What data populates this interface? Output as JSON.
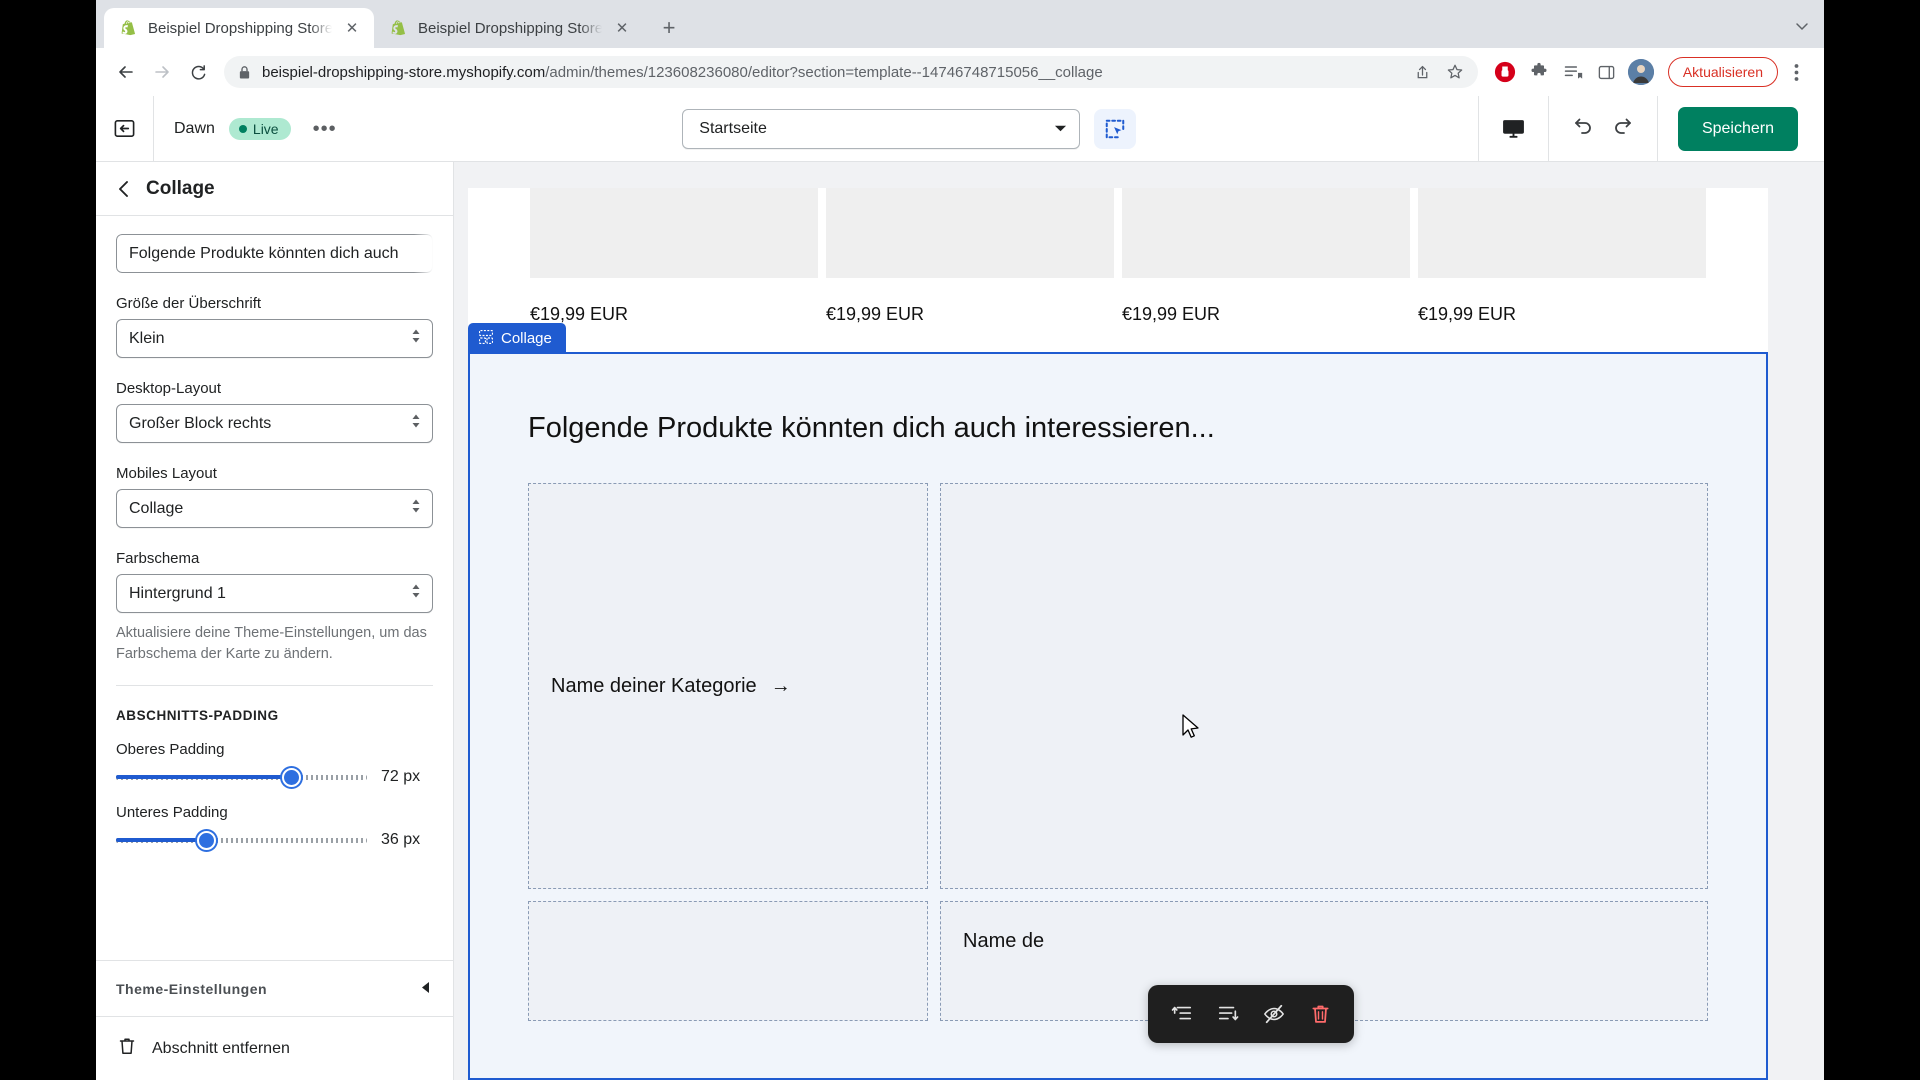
{
  "browser": {
    "tabs": [
      {
        "title": "Beispiel Dropshipping Store · D",
        "favicon": "shopify-icon",
        "active": true,
        "close_label": "✕"
      },
      {
        "title": "Beispiel Dropshipping Store · B",
        "favicon": "shopify-icon",
        "active": false,
        "close_label": "✕"
      }
    ],
    "new_tab_label": "+",
    "nav": {
      "back": "back-arrow-icon",
      "forward": "forward-arrow-icon",
      "reload": "reload-icon"
    },
    "omnibox": {
      "lock_icon": "lock-icon",
      "url_host": "beispiel-dropshipping-store.myshopify.com",
      "url_path": "/admin/themes/123608236080/editor?section=template--14746748715056__collage",
      "share_icon": "share-icon",
      "bookmark_icon": "star-icon"
    },
    "actions": {
      "adblock_icon": "adblock-icon",
      "extensions_icon": "puzzle-piece-icon",
      "reading_list_icon": "reading-list-icon",
      "side_panel_icon": "side-panel-icon",
      "profile_icon": "profile-avatar",
      "update_label": "Aktualisieren",
      "menu_icon": "kebab-menu-icon"
    }
  },
  "editor": {
    "exit_icon": "exit-editor-icon",
    "theme_name": "Dawn",
    "live_badge": "Live",
    "more_actions": "•••",
    "page_selector": {
      "value": "Startseite",
      "chevron": "chevron-down-icon"
    },
    "inspect_icon": "inspector-select-icon",
    "device_icon": "desktop-preview-icon",
    "undo_icon": "undo-icon",
    "redo_icon": "redo-icon",
    "save_label": "Speichern"
  },
  "sidebar": {
    "back_icon": "chevron-left-icon",
    "title": "Collage",
    "fields": [
      {
        "name": "heading-text",
        "type": "text",
        "label": "",
        "value": "Folgende Produkte könnten dich auch"
      },
      {
        "name": "heading-size",
        "type": "select",
        "label": "Größe der Überschrift",
        "value": "Klein"
      },
      {
        "name": "desktop-layout",
        "type": "select",
        "label": "Desktop-Layout",
        "value": "Großer Block rechts"
      },
      {
        "name": "mobile-layout",
        "type": "select",
        "label": "Mobiles Layout",
        "value": "Collage"
      },
      {
        "name": "color-scheme",
        "type": "select",
        "label": "Farbschema",
        "value": "Hintergrund 1"
      }
    ],
    "color_scheme_help": "Aktualisiere deine Theme-Einstellungen, um das Farbschema der Karte zu ändern.",
    "padding_section_title": "Abschnitts-Padding",
    "sliders": [
      {
        "name": "top-padding",
        "label": "Oberes Padding",
        "value": "72 px",
        "percent": 70
      },
      {
        "name": "bottom-padding",
        "label": "Unteres Padding",
        "value": "36 px",
        "percent": 36
      }
    ],
    "theme_settings_label": "Theme-Einstellungen",
    "theme_settings_chevron": "chevron-left-icon",
    "remove_section": {
      "icon": "trash-icon",
      "label": "Abschnitt entfernen"
    }
  },
  "preview": {
    "product_prices": [
      "€19,99 EUR",
      "€19,99 EUR",
      "€19,99 EUR",
      "€19,99 EUR"
    ],
    "section_tag": {
      "icon": "collage-section-icon",
      "label": "Collage"
    },
    "collage_heading": "Folgende Produkte könnten dich auch interessieren...",
    "blocks": [
      {
        "name": "collage-block-1",
        "label": "Name deiner Kategorie",
        "arrow": "→"
      },
      {
        "name": "collage-block-2",
        "label": ""
      },
      {
        "name": "collage-block-3",
        "label": ""
      },
      {
        "name": "collage-block-4",
        "label": "Name de"
      }
    ],
    "float_toolbar": [
      {
        "name": "move-up-button",
        "icon": "move-up-icon"
      },
      {
        "name": "move-down-button",
        "icon": "move-down-icon"
      },
      {
        "name": "hide-block-button",
        "icon": "eye-slash-icon"
      },
      {
        "name": "delete-block-button",
        "icon": "trash-icon"
      }
    ]
  },
  "colors": {
    "accent_blue": "#1f5bd0",
    "shopify_green": "#008060",
    "danger_red": "#d93025",
    "tab_strip": "#dee1e6"
  }
}
